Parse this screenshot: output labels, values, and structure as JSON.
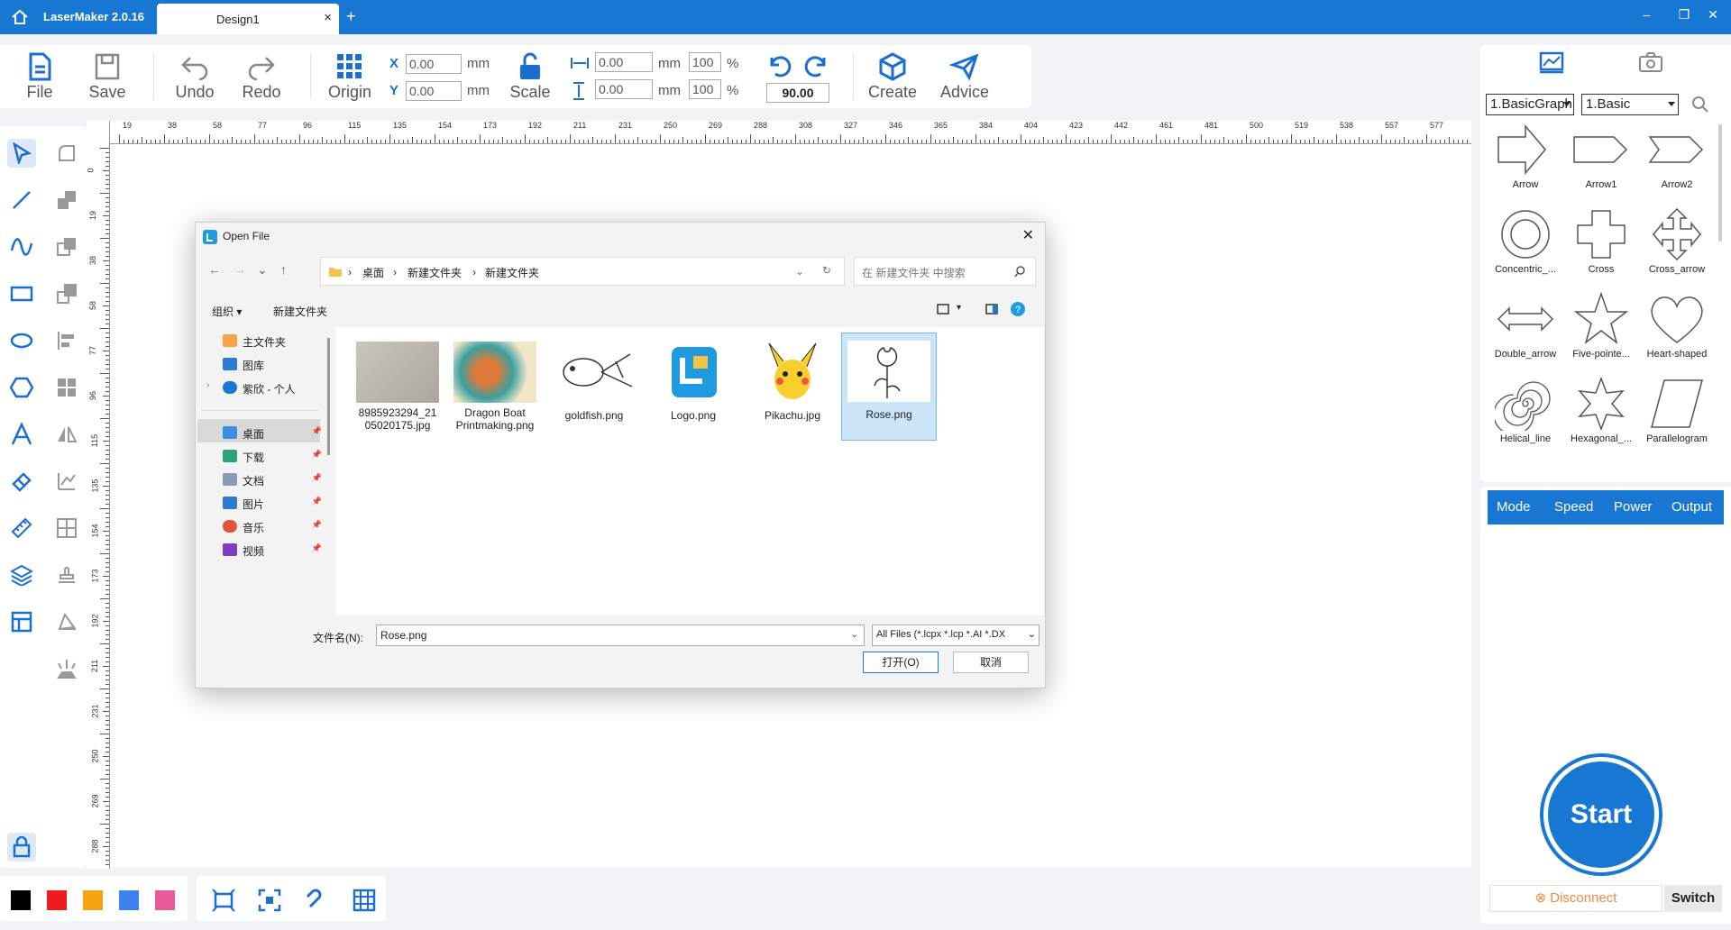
{
  "titlebar": {
    "app": "LaserMaker 2.0.16",
    "tab": "Design1",
    "close": "×",
    "plus": "+",
    "minimize": "–",
    "restore": "❐",
    "close_window": "✕"
  },
  "toolbar": {
    "file": "File",
    "save": "Save",
    "undo": "Undo",
    "redo": "Redo",
    "origin": "Origin",
    "scale": "Scale",
    "create": "Create",
    "advice": "Advice",
    "x_label": "X",
    "y_label": "Y",
    "x_value": "0.00",
    "y_value": "0.00",
    "unit": "mm",
    "w_value": "0.00",
    "h_value": "0.00",
    "w_pct": "100",
    "h_pct": "100",
    "pct": "%",
    "rotate_value": "90.00"
  },
  "ruler": {
    "unit": "mm",
    "top_ticks": [
      "19",
      "38",
      "58",
      "77",
      "96",
      "115",
      "135",
      "154",
      "173",
      "192",
      "211",
      "231",
      "250",
      "269",
      "288",
      "308",
      "327",
      "346",
      "365",
      "384",
      "404",
      "423",
      "442",
      "461",
      "481",
      "500",
      "519",
      "538",
      "557",
      "577"
    ],
    "left_ticks": [
      "0",
      "19",
      "38",
      "58",
      "77",
      "96",
      "115",
      "135",
      "154",
      "173",
      "192",
      "211",
      "231",
      "250",
      "269",
      "288"
    ]
  },
  "colors": {
    "swatches": [
      "#000000",
      "#ee1c1c",
      "#f5a40d",
      "#3b82f0",
      "#e85a9a"
    ],
    "accent": "#1877d2"
  },
  "right_panel": {
    "select1": "1.BasicGraph",
    "select2": "1.Basic",
    "shapes": [
      "Arrow",
      "Arrow1",
      "Arrow2",
      "Concentric_...",
      "Cross",
      "Cross_arrow",
      "Double_arrow",
      "Five-pointe...",
      "Heart-shaped",
      "Helical_line",
      "Hexagonal_...",
      "Parallelogram"
    ]
  },
  "bottom_panel": {
    "tabs": [
      "Mode",
      "Speed",
      "Power",
      "Output"
    ],
    "start": "Start",
    "disconnect": "Disconnect",
    "switch": "Switch"
  },
  "dialog": {
    "title": "Open File",
    "breadcrumb": [
      "桌面",
      "新建文件夹",
      "新建文件夹"
    ],
    "search_placeholder": "在 新建文件夹 中搜索",
    "organize": "组织 ▾",
    "new_folder": "新建文件夹",
    "nav": [
      {
        "label": "主文件夹"
      },
      {
        "label": "图库"
      },
      {
        "label": "紫欣 - 个人"
      },
      {
        "label": "桌面"
      },
      {
        "label": "下载"
      },
      {
        "label": "文档"
      },
      {
        "label": "图片"
      },
      {
        "label": "音乐"
      },
      {
        "label": "视频"
      }
    ],
    "files": [
      {
        "name": "8985923294_2105020175.jpg"
      },
      {
        "name": "Dragon Boat Printmaking.png"
      },
      {
        "name": "goldfish.png"
      },
      {
        "name": "Logo.png"
      },
      {
        "name": "Pikachu.jpg"
      },
      {
        "name": "Rose.png"
      }
    ],
    "filename_label": "文件名(N):",
    "filename_value": "Rose.png",
    "filetype": "All Files (*.lcpx *.lcp *.AI *.DX",
    "open": "打开(O)",
    "cancel": "取消"
  }
}
